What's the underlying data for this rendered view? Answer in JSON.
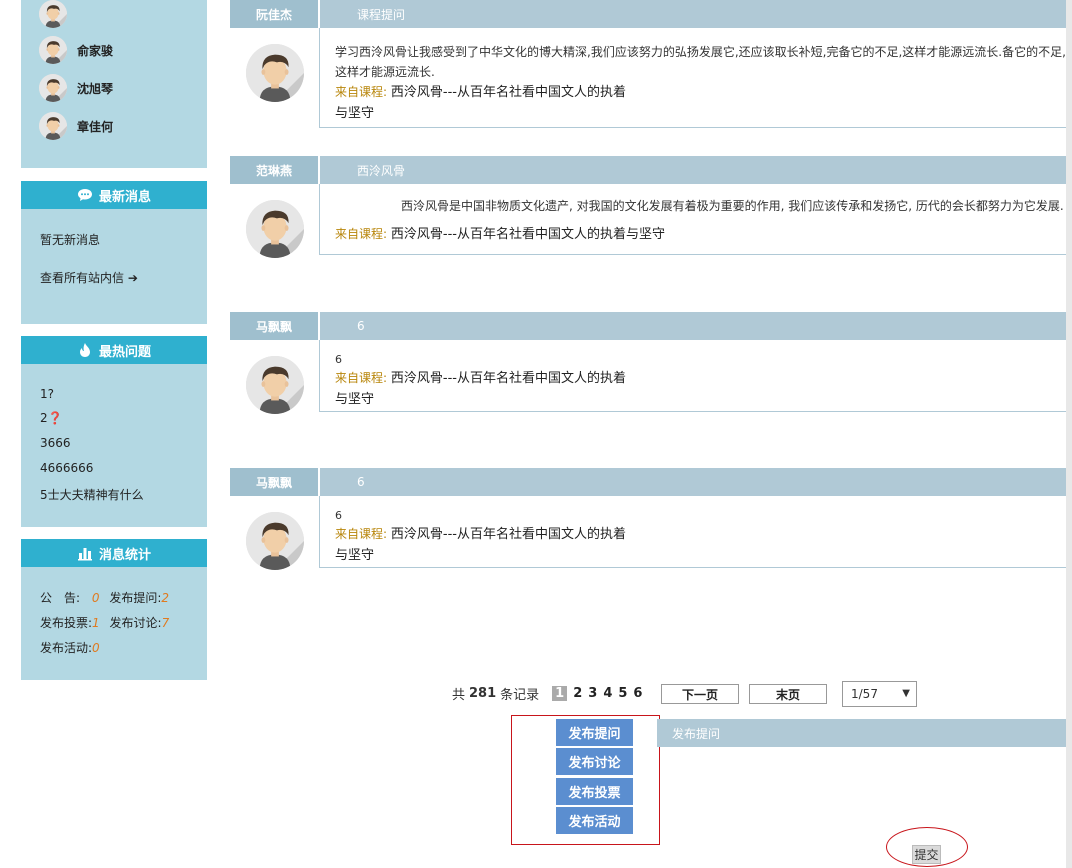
{
  "sidebar": {
    "users": [
      {
        "name": ""
      },
      {
        "name": "俞家骏"
      },
      {
        "name": "沈旭琴"
      },
      {
        "name": "章佳何"
      }
    ],
    "news": {
      "title": "最新消息",
      "empty": "暂无新消息",
      "link": "查看所有站内信",
      "link_arrow": "➔"
    },
    "hot": {
      "title": "最热问题",
      "items": [
        "1?",
        "2❓",
        "3666",
        "4666666",
        "5士大夫精神有什么"
      ]
    },
    "stats": {
      "title": "消息统计",
      "notice_label": "公　告:",
      "notice_value": "0",
      "question_label": "发布提问:",
      "question_value": "2",
      "vote_label": "发布投票:",
      "vote_value": "1",
      "discuss_label": "发布讨论:",
      "discuss_value": "7",
      "activity_label": "发布活动:",
      "activity_value": "0"
    }
  },
  "posts": [
    {
      "author": "阮佳杰",
      "title": "课程提问",
      "content": "学习西泠风骨让我感受到了中华文化的博大精深,我们应该努力的弘扬发展它,还应该取长补短,完备它的不足,这样才能源远流长.备它的不足,这样才能源远流长.",
      "from_label": "来自课程:",
      "course_line1": "西泠风骨---从百年名社看中国文人的执着",
      "course_line2": "与坚守"
    },
    {
      "author": "范琳燕",
      "title": "西泠风骨",
      "content": "西泠风骨是中国非物质文化遗产, 对我国的文化发展有着极为重要的作用, 我们应该传承和发扬它, 历代的会长都努力为它发展.",
      "from_label": "来自课程:",
      "course_line1": "西泠风骨---从百年名社看中国文人的执着与坚守",
      "course_line2": ""
    },
    {
      "author": "马飘飘",
      "title": "6",
      "content": "6",
      "from_label": "来自课程:",
      "course_line1": "西泠风骨---从百年名社看中国文人的执着",
      "course_line2": "与坚守"
    },
    {
      "author": "马飘飘",
      "title": "6",
      "content": "6",
      "from_label": "来自课程:",
      "course_line1": "西泠风骨---从百年名社看中国文人的执着",
      "course_line2": "与坚守"
    }
  ],
  "pager": {
    "prefix": "共",
    "total": "281",
    "suffix": "条记录",
    "pages": [
      "1",
      "2",
      "3",
      "4",
      "5",
      "6"
    ],
    "next": "下一页",
    "last": "末页",
    "select": "1/57"
  },
  "publish": {
    "question": "发布提问",
    "discuss": "发布讨论",
    "vote": "发布投票",
    "activity": "发布活动",
    "bar_title": "发布提问",
    "submit": "提交"
  },
  "colors": {
    "sidebar_bg": "#b3d8e3",
    "header_blue": "#2fb0cf",
    "post_bar": "#b0c9d6",
    "publish_btn": "#5b8ed0",
    "highlight_red": "#c8151b"
  }
}
